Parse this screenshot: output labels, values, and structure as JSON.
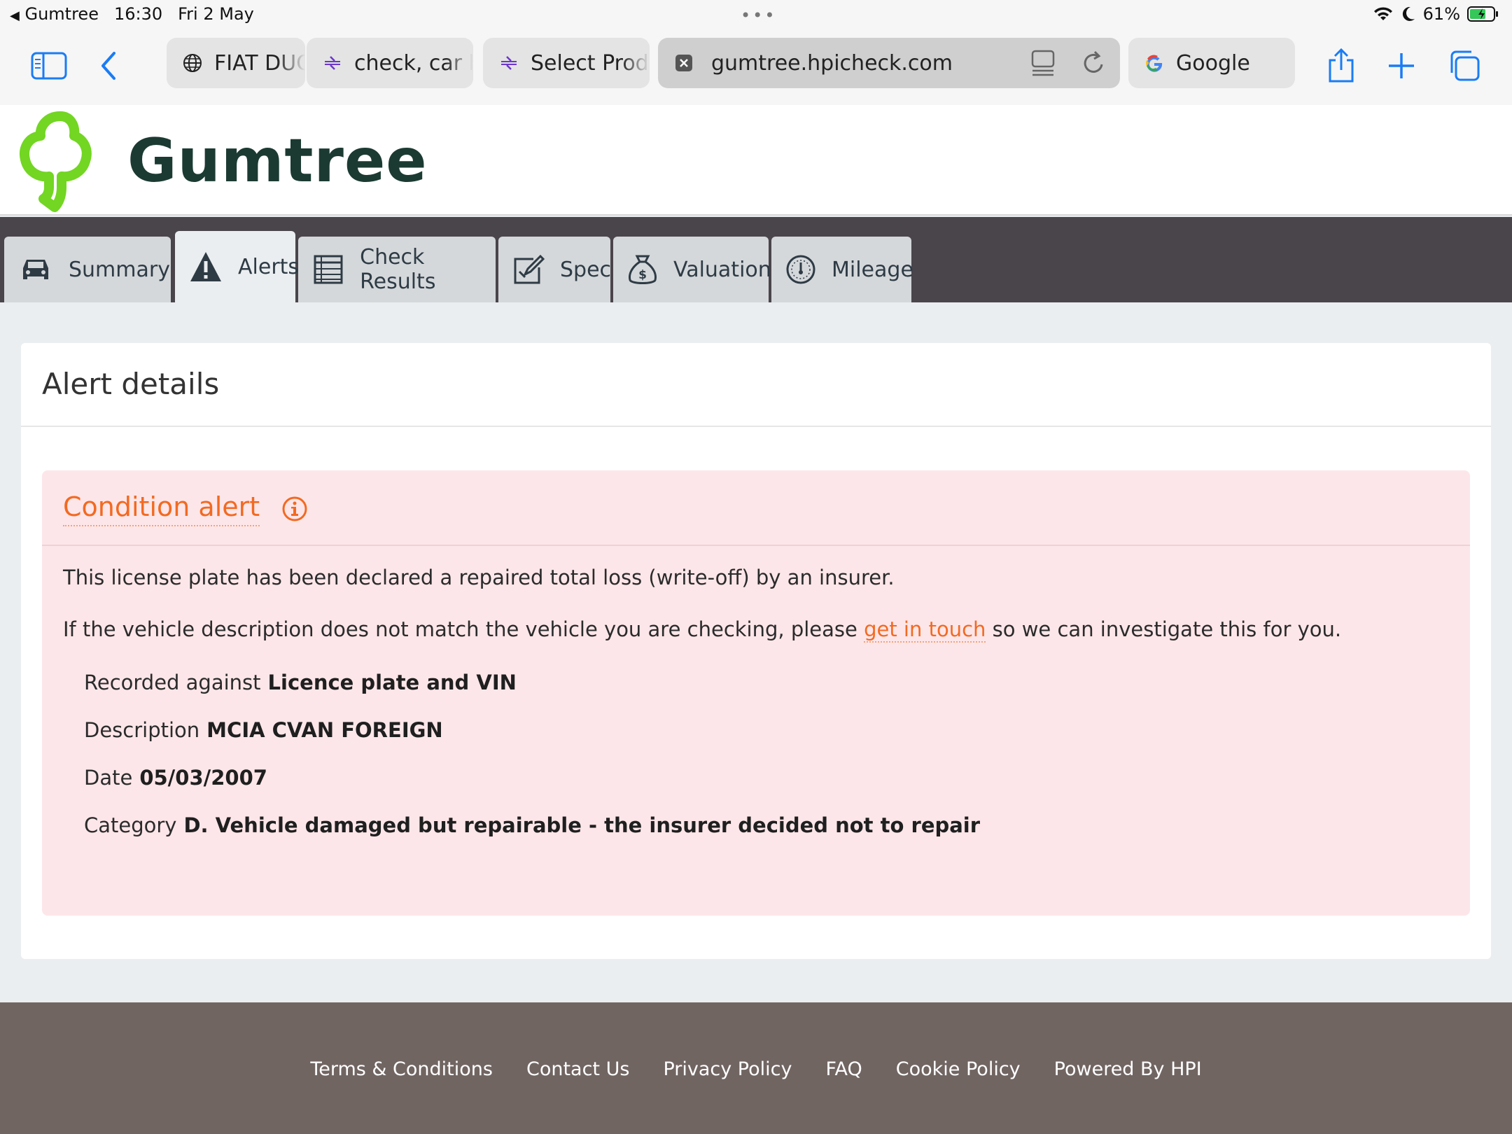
{
  "status_bar": {
    "back_app": "Gumtree",
    "time": "16:30",
    "date": "Fri 2 May",
    "battery": "61%"
  },
  "browser": {
    "tabs": [
      {
        "label": "FIAT DUCATO",
        "favicon": "globe-icon"
      },
      {
        "label": "check, car history",
        "favicon": "hpi-icon"
      },
      {
        "label": "Select Product",
        "favicon": "hpi-icon"
      },
      {
        "label": "gumtree.hpicheck.com",
        "favicon": "close-icon",
        "active": true
      },
      {
        "label": "Google",
        "favicon": "google-icon"
      }
    ]
  },
  "site": {
    "logo_text": "Gumtree",
    "brand_color": "#72d622"
  },
  "nav": {
    "tabs": [
      {
        "label": "Summary",
        "icon": "car-icon"
      },
      {
        "label": "Alerts",
        "icon": "warning-icon",
        "active": true
      },
      {
        "label": "Check Results",
        "icon": "list-icon"
      },
      {
        "label": "Spec",
        "icon": "edit-icon"
      },
      {
        "label": "Valuation",
        "icon": "money-bag-icon"
      },
      {
        "label": "Mileage",
        "icon": "gauge-icon"
      }
    ]
  },
  "card": {
    "title": "Alert details",
    "alert": {
      "title": "Condition alert",
      "accent_color": "#f26a21",
      "line1": "This license plate has been declared a repaired total loss (write-off) by an insurer.",
      "line2_before": "If the vehicle description does not match the vehicle you are checking, please ",
      "line2_link": "get in touch",
      "line2_after": " so we can investigate this for you.",
      "rows": [
        {
          "label": "Recorded against",
          "value": "Licence plate and VIN"
        },
        {
          "label": "Description",
          "value": "MCIA CVAN FOREIGN"
        },
        {
          "label": "Date",
          "value": "05/03/2007"
        },
        {
          "label": "Category",
          "value": "D. Vehicle damaged but repairable - the insurer decided not to repair"
        }
      ]
    }
  },
  "footer": {
    "links": [
      "Terms & Conditions",
      "Contact Us",
      "Privacy Policy",
      "FAQ",
      "Cookie Policy",
      "Powered By HPI"
    ]
  }
}
